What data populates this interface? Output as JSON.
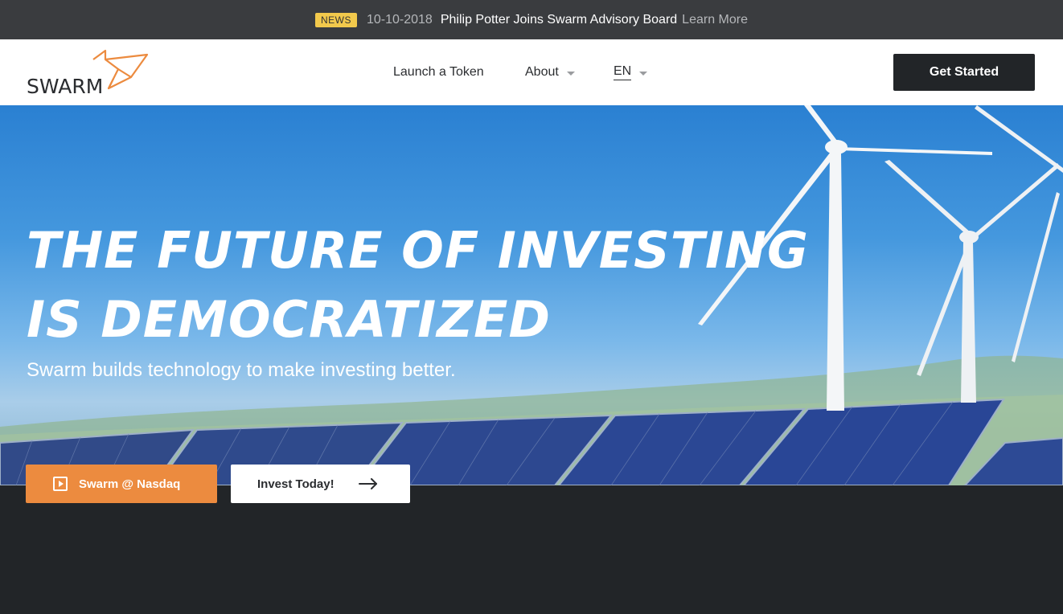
{
  "news": {
    "badge": "NEWS",
    "date": "10-10-2018",
    "title": "Philip Potter Joins Swarm Advisory Board",
    "link": "Learn More"
  },
  "header": {
    "logo_text": "SWARM",
    "nav": {
      "launch": "Launch a Token",
      "about": "About",
      "lang": "EN"
    },
    "cta": "Get Started"
  },
  "hero": {
    "headline_line1": "THE FUTURE OF INVESTING",
    "headline_line2": "IS DEMOCRATIZED",
    "subhead": "Swarm builds technology to make investing better.",
    "btn_nasdaq": "Swarm @ Nasdaq",
    "btn_invest": "Invest Today!"
  },
  "colors": {
    "accent_orange": "#ec8b3f",
    "dark": "#222528",
    "news_badge": "#f2c94c"
  }
}
